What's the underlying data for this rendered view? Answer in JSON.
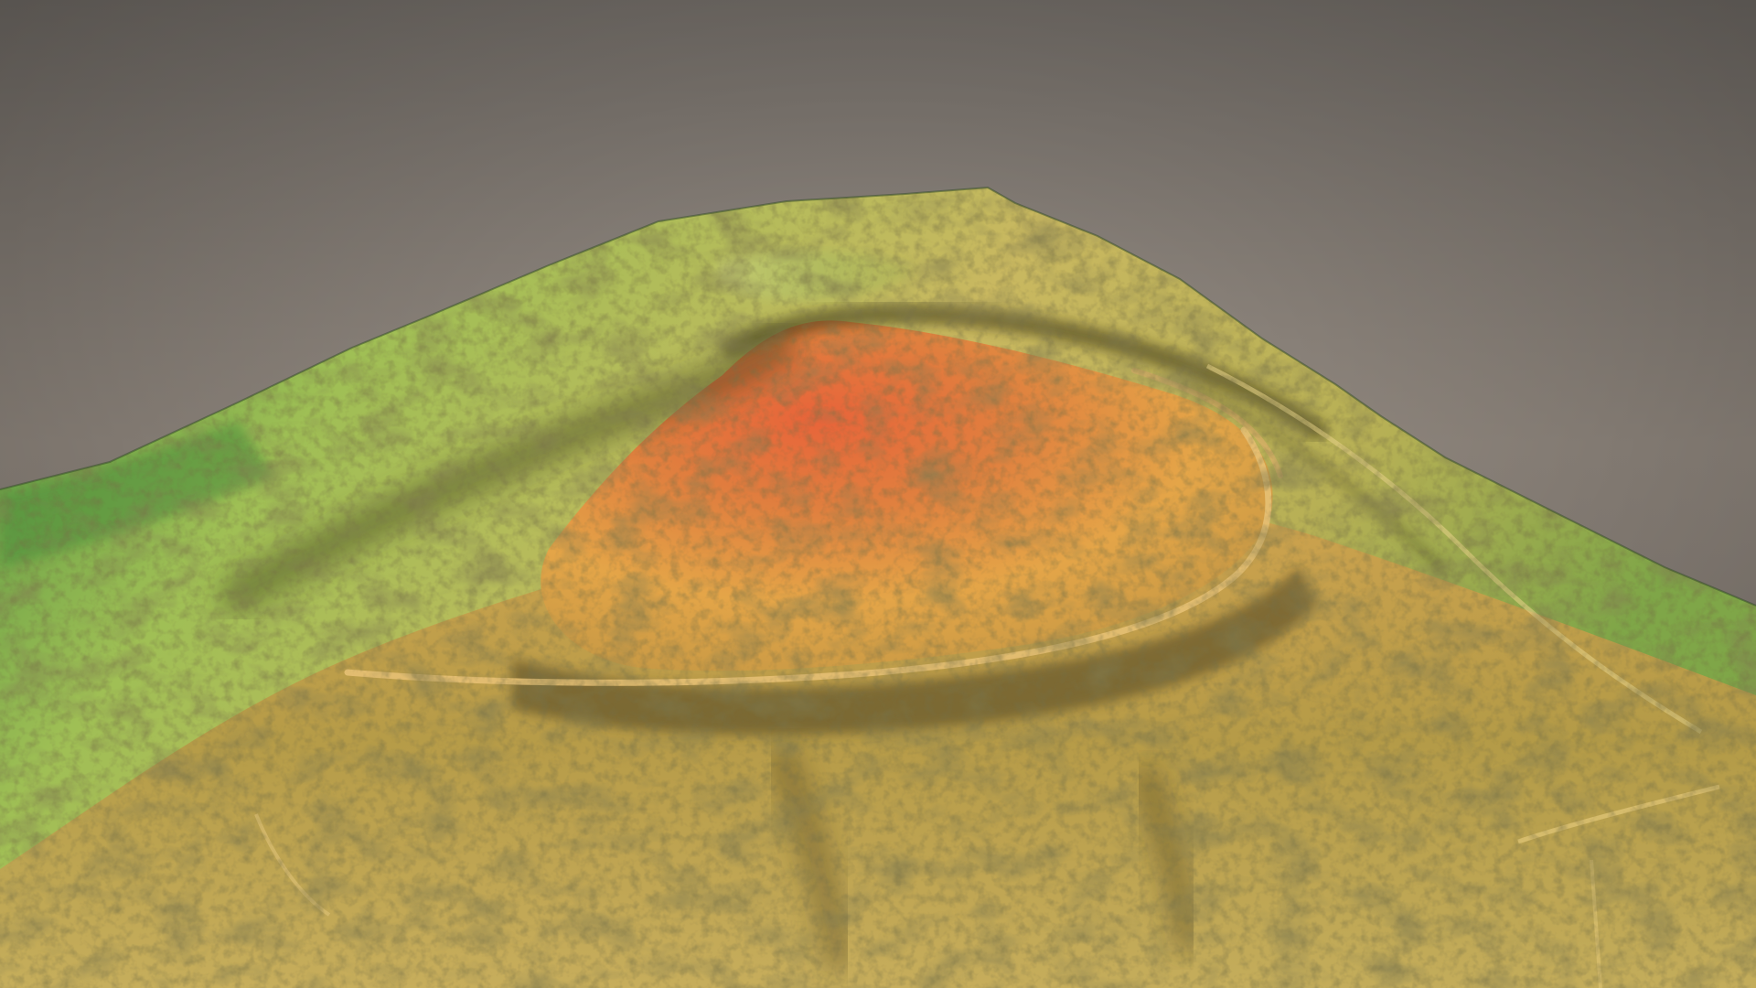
{
  "scene": {
    "description_kind": "elevation-shaded-terrain",
    "colors": {
      "sky_top": "#7d7771",
      "sky_mid": "#a1978d",
      "sky_low": "#948a82",
      "low_elevation": "#3f8a3c",
      "mid_low_elevation": "#9fbf55",
      "mid_elevation": "#c9b860",
      "high_elevation": "#e4a548",
      "peak_elevation": "#e8643a",
      "shadow": "#3e3a20"
    }
  }
}
